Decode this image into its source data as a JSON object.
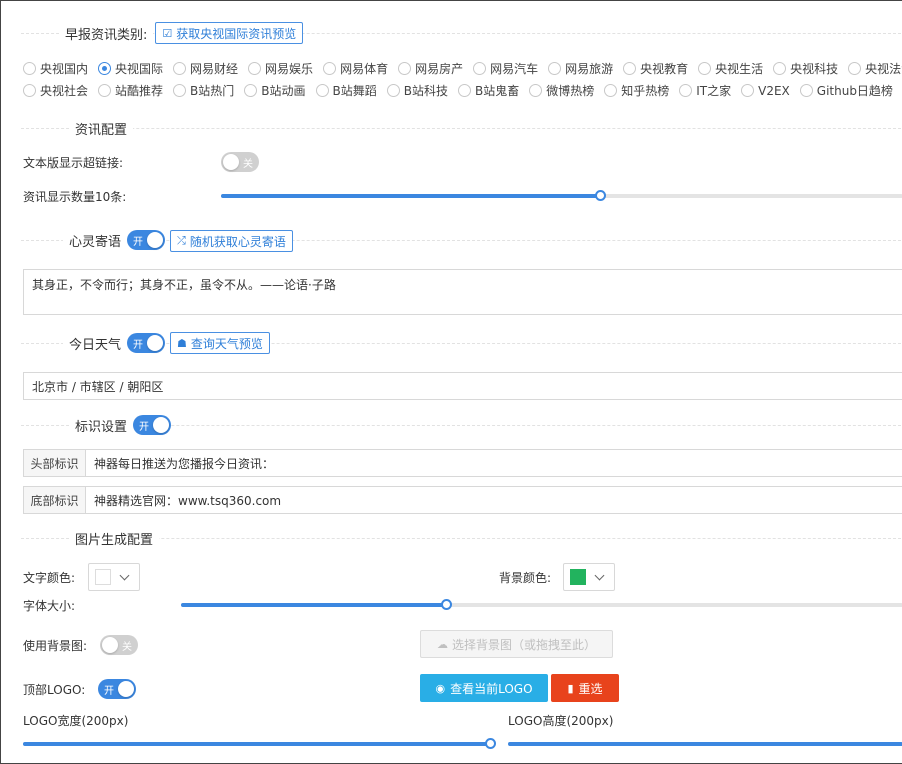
{
  "news_category": {
    "label": "早报资讯类别:",
    "fetch_button": "获取央视国际资讯预览",
    "options_row1": [
      "央视国内",
      "央视国际",
      "网易财经",
      "网易娱乐",
      "网易体育",
      "网易房产",
      "网易汽车",
      "网易旅游",
      "央视教育",
      "央视生活",
      "央视科技",
      "央视法治"
    ],
    "options_row2": [
      "央视社会",
      "站酷推荐",
      "B站热门",
      "B站动画",
      "B站舞蹈",
      "B站科技",
      "B站鬼畜",
      "微博热榜",
      "知乎热榜",
      "IT之家",
      "V2EX",
      "Github日趋榜"
    ],
    "selected": "央视国际"
  },
  "news_config": {
    "title": "资讯配置",
    "hyperlink_label": "文本版显示超链接:",
    "hyperlink_switch": "关",
    "count_label": "资讯显示数量10条:",
    "count_progress": 0.555
  },
  "mind_message": {
    "title": "心灵寄语",
    "switch_text": "开",
    "random_button": "随机获取心灵寄语",
    "text": "其身正，不令而行；其身不正，虽令不从。——论语·子路"
  },
  "weather": {
    "title": "今日天气",
    "switch_text": "开",
    "query_button": "查询天气预览",
    "location": "北京市 / 市辖区 / 朝阳区"
  },
  "identity": {
    "title": "标识设置",
    "switch_text": "开",
    "header_label": "头部标识",
    "header_value": "神器每日推送为您播报今日资讯：",
    "footer_label": "底部标识",
    "footer_value": "神器精选官网：www.tsq360.com"
  },
  "image_config": {
    "title": "图片生成配置",
    "text_color_label": "文字颜色:",
    "text_color": "#ffffff",
    "bg_color_label": "背景颜色:",
    "bg_color": "#22b35e",
    "font_size_label": "字体大小:",
    "font_size_progress": 0.367,
    "use_bg_label": "使用背景图:",
    "use_bg_switch": "关",
    "select_bg_button": "选择背景图（或拖拽至此）",
    "top_logo_label": "顶部LOGO:",
    "top_logo_switch": "开",
    "view_logo_button": "查看当前LOGO",
    "reset_button": "重选",
    "logo_width_label": "LOGO宽度(200px)",
    "logo_width_progress": 1.0,
    "logo_height_label": "LOGO高度(200px)",
    "logo_height_progress": 1.0
  },
  "colors": {
    "accent": "#3b87e0",
    "info_button": "#29aee6",
    "danger_button": "#e8431c"
  }
}
